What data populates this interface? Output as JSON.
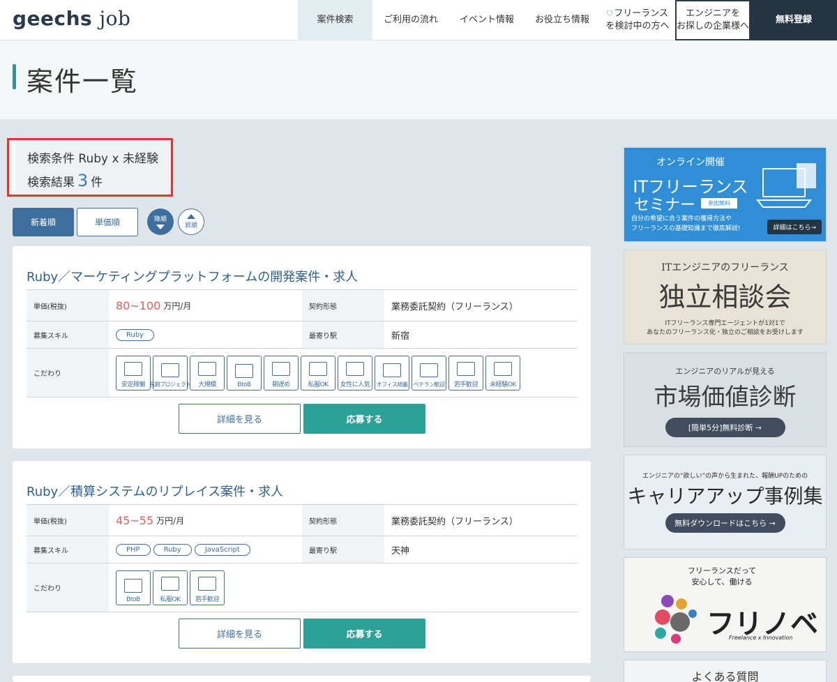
{
  "header": {
    "logo_main": "geechs",
    "logo_sub": "job",
    "nav": [
      {
        "label": "案件検索"
      },
      {
        "label": "ご利用の流れ"
      },
      {
        "label": "イベント情報"
      },
      {
        "label": "お役立ち情報"
      }
    ],
    "freelance_line1": "フリーランス",
    "freelance_line2": "を検討中の方へ",
    "company_line1": "エンジニアを",
    "company_line2": "お探しの企業様へ",
    "register": "無料登録"
  },
  "page_title": "案件一覧",
  "search": {
    "condition_label": "検索条件",
    "condition_value": "Ruby x 未経験",
    "result_label": "検索結果",
    "result_count": "3",
    "result_unit": "件"
  },
  "sort": {
    "newest": "新着順",
    "price": "単価順",
    "desc": "降順",
    "asc": "昇順"
  },
  "labels": {
    "price": "単価(税抜)",
    "contract": "契約形態",
    "skills": "募集スキル",
    "station": "最寄り駅",
    "features": "こだわり",
    "detail_btn": "詳細を見る",
    "apply_btn": "応募する"
  },
  "jobs": [
    {
      "title": "Ruby／マーケティングプラットフォームの開発案件・求人",
      "price": "80~100",
      "price_unit": "万円/月",
      "contract": "業務委託契約（フリーランス）",
      "skills": [
        "Ruby"
      ],
      "station": "新宿",
      "features": [
        "安定稼働",
        "長期プロジェクト",
        "大規模",
        "BtoB",
        "朝遅め",
        "私服OK",
        "女性に人気",
        "オフィス綺麗",
        "ベテラン歓迎",
        "若手歓迎",
        "未経験OK"
      ]
    },
    {
      "title": "Ruby／積算システムのリプレイス案件・求人",
      "price": "45~55",
      "price_unit": "万円/月",
      "contract": "業務委託契約（フリーランス）",
      "skills": [
        "PHP",
        "Ruby",
        "JavaScript"
      ],
      "station": "天神",
      "features": [
        "BtoB",
        "私服OK",
        "若手歓迎"
      ]
    }
  ],
  "banners": {
    "b1_top": "オンライン開催",
    "b1_title1": "ITフリーランス",
    "b1_title2": "セミナー",
    "b1_tag": "参加無料",
    "b1_desc1": "自分の希望に合う案件の獲得方法や",
    "b1_desc2": "フリーランスの基礎知識まで徹底解説!",
    "b1_btn": "詳細はこちら→",
    "b2_top": "ITエンジニアのフリーランス",
    "b2_title": "独立相談会",
    "b2_desc1": "ITフリーランス専門エージェントが1対1で",
    "b2_desc2": "あなたのフリーランス化・独立のご相談をお受けします",
    "b3_top": "エンジニアのリアルが見える",
    "b3_title": "市場価値診断",
    "b3_btn": "[簡単5分]無料診断 →",
    "b4_top": "エンジニアの“欲しい”の声から生まれた、報酬UPのための",
    "b4_title": "キャリアアップ事例集",
    "b4_btn": "無料ダウンロードはこちら →",
    "b5_line1": "フリーランスだって",
    "b5_line2": "安心して、働ける",
    "b5_logo": "フリノベ",
    "b5_sub": "Freelance x Innovation",
    "b6_title": "よくある質問"
  },
  "colors": {
    "accent": "#3e6e9e",
    "apply": "#2ba197",
    "price": "#e85d5d",
    "highlight_border": "#e8332a",
    "header_dark": "#243443"
  }
}
